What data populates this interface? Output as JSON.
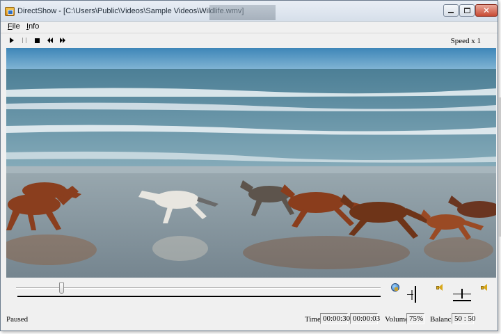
{
  "window": {
    "title": "DirectShow - [C:\\Users\\Public\\Videos\\Sample Videos\\Wildlife.wmv]",
    "controls": {
      "minimize": "minimize",
      "maximize": "maximize",
      "close": "✕"
    }
  },
  "menu": {
    "file": "File",
    "info": "Info"
  },
  "toolbar": {
    "buttons": [
      "play-icon",
      "pause-icon",
      "stop-icon",
      "previous-icon",
      "next-icon"
    ],
    "speed_label": "Speed x 1"
  },
  "video": {
    "scene": "horses-running-on-beach"
  },
  "seek": {
    "position_fraction": 0.125
  },
  "status": {
    "state": "Paused",
    "time_label": "Time",
    "current_time": "00:00:30",
    "duration": "00:00:03",
    "volume_label": "Volume",
    "volume_value": "75%",
    "balance_label": "Balance",
    "balance_value": "50 : 50"
  },
  "colors": {
    "sky": "#4a8fbd",
    "sea": "#7ba6b8",
    "sand": "#8e9ea8",
    "horse_brown": "#8a3e1e",
    "close_red": "#c84a33"
  }
}
